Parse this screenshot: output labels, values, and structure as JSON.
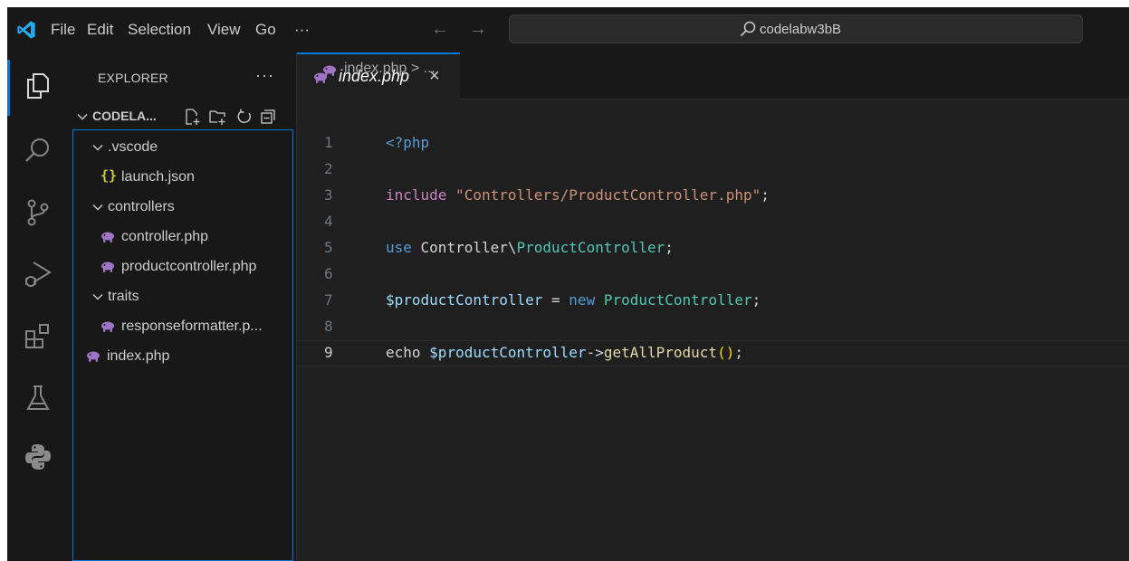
{
  "titlebar": {
    "menu": [
      "File",
      "Edit",
      "Selection",
      "View",
      "Go",
      "···"
    ],
    "search_text": "codelabw3bB"
  },
  "activitybar": {
    "icons": [
      "explorer-icon",
      "search-icon",
      "source-control-icon",
      "run-debug-icon",
      "extensions-icon",
      "testing-icon",
      "python-icon"
    ]
  },
  "sidebar": {
    "title": "EXPLORER",
    "more": "···",
    "section_label": "CODELA...",
    "tree": [
      {
        "label": ".vscode",
        "type": "folder",
        "expanded": true
      },
      {
        "label": "launch.json",
        "type": "json"
      },
      {
        "label": "controllers",
        "type": "folder",
        "expanded": true
      },
      {
        "label": "controller.php",
        "type": "php"
      },
      {
        "label": "productcontroller.php",
        "type": "php"
      },
      {
        "label": "traits",
        "type": "folder",
        "expanded": true
      },
      {
        "label": "responseformatter.p...",
        "type": "php"
      },
      {
        "label": "index.php",
        "type": "php"
      }
    ],
    "json_icon_glyph": "{}"
  },
  "editor": {
    "tab_label": "index.php",
    "tab_close": "×",
    "breadcrumb": "index.php > ...",
    "current_line": 9,
    "line_numbers": [
      "1",
      "2",
      "3",
      "4",
      "5",
      "6",
      "7",
      "8",
      "9"
    ],
    "lines": [
      [
        {
          "t": "tag",
          "v": "<?php"
        }
      ],
      [],
      [
        {
          "t": "kw",
          "v": "include"
        },
        {
          "t": "plain",
          "v": " "
        },
        {
          "t": "str",
          "v": "\"Controllers/ProductController.php\""
        },
        {
          "t": "plain",
          "v": ";"
        }
      ],
      [],
      [
        {
          "t": "use",
          "v": "use"
        },
        {
          "t": "plain",
          "v": " Controller\\"
        },
        {
          "t": "cls",
          "v": "ProductController"
        },
        {
          "t": "plain",
          "v": ";"
        }
      ],
      [],
      [
        {
          "t": "var",
          "v": "$productController"
        },
        {
          "t": "op",
          "v": " = "
        },
        {
          "t": "new",
          "v": "new"
        },
        {
          "t": "plain",
          "v": " "
        },
        {
          "t": "cls",
          "v": "ProductController"
        },
        {
          "t": "plain",
          "v": ";"
        }
      ],
      [],
      [
        {
          "t": "plain",
          "v": "echo "
        },
        {
          "t": "var",
          "v": "$productController"
        },
        {
          "t": "op",
          "v": "->"
        },
        {
          "t": "fn",
          "v": "getAllProduct"
        },
        {
          "t": "paren",
          "v": "()"
        },
        {
          "t": "plain",
          "v": ";"
        }
      ]
    ]
  },
  "colors": {
    "accent": "#0078d4",
    "php_icon": "#a074c4",
    "json_icon": "#cbcb41"
  }
}
